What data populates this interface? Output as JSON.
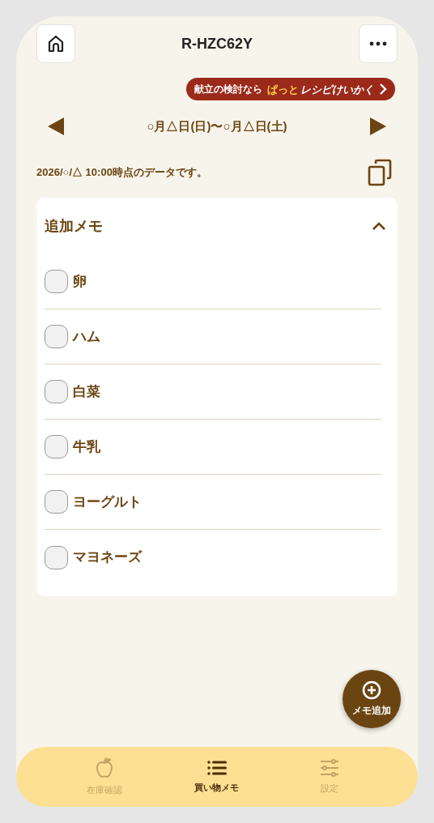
{
  "header": {
    "title": "R-HZC62Y"
  },
  "banner": {
    "text": "献立の検討なら",
    "logo_small": "ぱっと",
    "logo": "レシピけいかく"
  },
  "date_range": "○月△日(日)〜○月△日(土)",
  "data_note": "2026/○/△ 10:00時点のデータです。",
  "memo_card": {
    "title": "追加メモ",
    "expanded": true,
    "items": [
      {
        "label": "卵",
        "checked": false
      },
      {
        "label": "ハム",
        "checked": false
      },
      {
        "label": "白菜",
        "checked": false
      },
      {
        "label": "牛乳",
        "checked": false
      },
      {
        "label": "ヨーグルト",
        "checked": false
      },
      {
        "label": "マヨネーズ",
        "checked": false
      }
    ]
  },
  "fab": {
    "label": "メモ追加"
  },
  "nav": [
    {
      "kind": "apple",
      "label": "在庫確認",
      "selected": false
    },
    {
      "kind": "list",
      "label": "買い物メモ",
      "selected": true
    },
    {
      "kind": "sliders",
      "label": "設定",
      "selected": false
    }
  ]
}
